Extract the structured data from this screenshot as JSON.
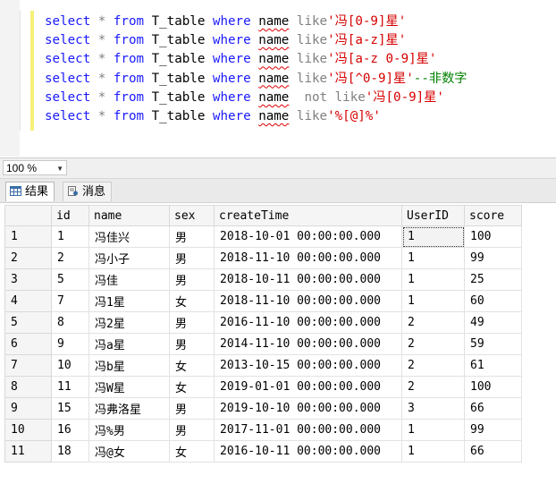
{
  "editor": {
    "lines": [
      [
        {
          "t": "select",
          "c": "kw"
        },
        {
          "t": " * ",
          "c": "op"
        },
        {
          "t": "from",
          "c": "kw"
        },
        {
          "t": " T_table ",
          "c": "id"
        },
        {
          "t": "where",
          "c": "kw"
        },
        {
          "t": " ",
          "c": "id"
        },
        {
          "t": "name",
          "c": "id squig"
        },
        {
          "t": " like",
          "c": "op"
        },
        {
          "t": "'冯[0-9]星'",
          "c": "str"
        }
      ],
      [
        {
          "t": "select",
          "c": "kw"
        },
        {
          "t": " * ",
          "c": "op"
        },
        {
          "t": "from",
          "c": "kw"
        },
        {
          "t": " T_table ",
          "c": "id"
        },
        {
          "t": "where",
          "c": "kw"
        },
        {
          "t": " ",
          "c": "id"
        },
        {
          "t": "name",
          "c": "id squig"
        },
        {
          "t": " like",
          "c": "op"
        },
        {
          "t": "'冯[a-z]星'",
          "c": "str"
        }
      ],
      [
        {
          "t": "select",
          "c": "kw"
        },
        {
          "t": " * ",
          "c": "op"
        },
        {
          "t": "from",
          "c": "kw"
        },
        {
          "t": " T_table ",
          "c": "id"
        },
        {
          "t": "where",
          "c": "kw"
        },
        {
          "t": " ",
          "c": "id"
        },
        {
          "t": "name",
          "c": "id squig"
        },
        {
          "t": " like",
          "c": "op"
        },
        {
          "t": "'冯[a-z 0-9]星'",
          "c": "str"
        }
      ],
      [
        {
          "t": "select",
          "c": "kw"
        },
        {
          "t": " * ",
          "c": "op"
        },
        {
          "t": "from",
          "c": "kw"
        },
        {
          "t": " T_table ",
          "c": "id"
        },
        {
          "t": "where",
          "c": "kw"
        },
        {
          "t": " ",
          "c": "id"
        },
        {
          "t": "name",
          "c": "id squig"
        },
        {
          "t": " like",
          "c": "op"
        },
        {
          "t": "'冯[^0-9]星'",
          "c": "str"
        },
        {
          "t": "--非数字",
          "c": "cmt"
        }
      ],
      [
        {
          "t": "select",
          "c": "kw"
        },
        {
          "t": " * ",
          "c": "op"
        },
        {
          "t": "from",
          "c": "kw"
        },
        {
          "t": " T_table ",
          "c": "id"
        },
        {
          "t": "where",
          "c": "kw"
        },
        {
          "t": " ",
          "c": "id"
        },
        {
          "t": "name",
          "c": "id squig"
        },
        {
          "t": "  not like",
          "c": "op"
        },
        {
          "t": "'冯[0-9]星'",
          "c": "str"
        }
      ],
      [
        {
          "t": "select",
          "c": "kw"
        },
        {
          "t": " * ",
          "c": "op"
        },
        {
          "t": "from",
          "c": "kw"
        },
        {
          "t": " T_table ",
          "c": "id"
        },
        {
          "t": "where",
          "c": "kw"
        },
        {
          "t": " ",
          "c": "id"
        },
        {
          "t": "name",
          "c": "id squig"
        },
        {
          "t": " like",
          "c": "op"
        },
        {
          "t": "'%[@]%'",
          "c": "str"
        }
      ]
    ]
  },
  "zoom": {
    "value": "100 %",
    "arrow_icon": "chevron-down-icon"
  },
  "tabs": [
    {
      "label": "结果",
      "icon": "grid-icon",
      "active": true
    },
    {
      "label": "消息",
      "icon": "message-icon",
      "active": false
    }
  ],
  "grid": {
    "columns": [
      "id",
      "name",
      "sex",
      "createTime",
      "UserID",
      "score"
    ],
    "rows": [
      [
        "1",
        "冯佳兴",
        "男",
        "2018-10-01 00:00:00.000",
        "1",
        "100"
      ],
      [
        "2",
        "冯小子",
        "男",
        "2018-11-10 00:00:00.000",
        "1",
        "99"
      ],
      [
        "5",
        "冯佳",
        "男",
        "2018-10-11 00:00:00.000",
        "1",
        "25"
      ],
      [
        "7",
        "冯1星",
        "女",
        "2018-11-10 00:00:00.000",
        "1",
        "60"
      ],
      [
        "8",
        "冯2星",
        "男",
        "2016-11-10 00:00:00.000",
        "2",
        "49"
      ],
      [
        "9",
        "冯a星",
        "男",
        "2014-11-10 00:00:00.000",
        "2",
        "59"
      ],
      [
        "10",
        "冯b星",
        "女",
        "2013-10-15 00:00:00.000",
        "2",
        "61"
      ],
      [
        "11",
        "冯W星",
        "女",
        "2019-01-01 00:00:00.000",
        "2",
        "100"
      ],
      [
        "15",
        "冯弗洛星",
        "男",
        "2019-10-10 00:00:00.000",
        "3",
        "66"
      ],
      [
        "16",
        "冯%男",
        "男",
        "2017-11-01 00:00:00.000",
        "1",
        "99"
      ],
      [
        "18",
        "冯@女",
        "女",
        "2016-10-11 00:00:00.000",
        "1",
        "66"
      ]
    ],
    "row_numbers": [
      "1",
      "2",
      "3",
      "4",
      "5",
      "6",
      "7",
      "8",
      "9",
      "10",
      "11"
    ]
  },
  "colors": {
    "keyword": "#1a1aff",
    "string": "#d60000",
    "comment": "#008000",
    "operator": "#808080"
  }
}
